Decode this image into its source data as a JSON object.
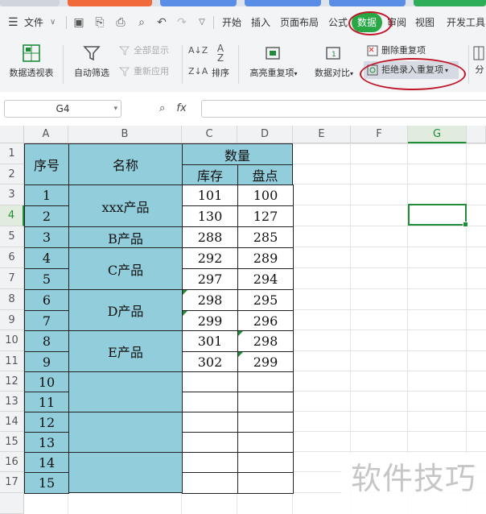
{
  "menu": {
    "file_label": "文件",
    "tabs": [
      "开始",
      "插入",
      "页面布局",
      "公式",
      "数据",
      "审阅",
      "视图",
      "开发工具"
    ],
    "active_tab": "数据"
  },
  "ribbon": {
    "pivot_table": "数据透视表",
    "auto_filter": "自动筛选",
    "show_all": "全部显示",
    "reapply": "重新应用",
    "sort": "排序",
    "highlight_duplicates": "高亮重复项",
    "data_compare": "数据对比",
    "remove_duplicates": "删除重复项",
    "reject_duplicates": "拒绝录入重复项",
    "split": "分"
  },
  "formula_bar": {
    "name_box": "G4",
    "fx_label": "fx",
    "formula": ""
  },
  "columns": [
    "A",
    "B",
    "C",
    "D",
    "E",
    "F",
    "G"
  ],
  "selected_column": "G",
  "rows": [
    "1",
    "2",
    "3",
    "4",
    "5",
    "6",
    "7",
    "8",
    "9",
    "10",
    "11",
    "12",
    "13",
    "14",
    "15",
    "16",
    "17"
  ],
  "selected_row": "4",
  "table": {
    "header_seq": "序号",
    "header_name": "名称",
    "header_qty": "数量",
    "header_stock": "库存",
    "header_count": "盘点",
    "names": [
      "xxx产品",
      "B产品",
      "C产品",
      "D产品",
      "E产品"
    ],
    "seq": [
      "1",
      "2",
      "3",
      "4",
      "5",
      "6",
      "7",
      "8",
      "9",
      "10",
      "11",
      "12",
      "13",
      "14",
      "15"
    ],
    "stock": [
      "101",
      "130",
      "288",
      "292",
      "297",
      "298",
      "299",
      "301",
      "302"
    ],
    "count": [
      "100",
      "127",
      "285",
      "289",
      "294",
      "295",
      "296",
      "298",
      "299"
    ]
  },
  "watermark": "软件技巧"
}
